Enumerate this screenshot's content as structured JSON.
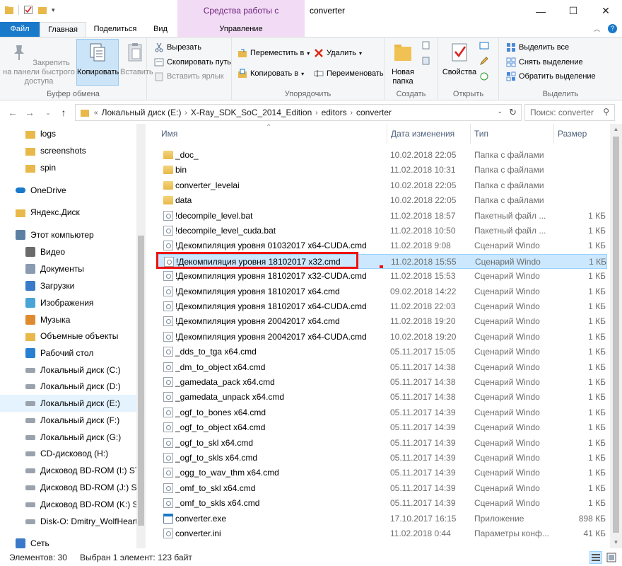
{
  "window": {
    "title": "converter",
    "context_tab_title": "Средства работы с приложениями",
    "controls": [
      "—",
      "☐",
      "✕"
    ]
  },
  "tabs": {
    "file": "Файл",
    "home": "Главная",
    "share": "Поделиться",
    "view": "Вид",
    "manage": "Управление"
  },
  "ribbon": {
    "clipboard": {
      "label": "Буфер обмена",
      "pin": "Закрепить на панели быстрого доступа",
      "copy": "Копировать",
      "paste": "Вставить",
      "cut": "Вырезать",
      "copy_path": "Скопировать путь",
      "paste_shortcut": "Вставить ярлык"
    },
    "organize": {
      "label": "Упорядочить",
      "move_to": "Переместить в",
      "copy_to": "Копировать в",
      "delete": "Удалить",
      "rename": "Переименовать"
    },
    "new": {
      "label": "Создать",
      "new_folder": "Новая папка"
    },
    "open": {
      "label": "Открыть",
      "properties": "Свойства"
    },
    "select": {
      "label": "Выделить",
      "select_all": "Выделить все",
      "select_none": "Снять выделение",
      "invert": "Обратить выделение"
    }
  },
  "address": {
    "prefix": "«",
    "crumbs": [
      "Локальный диск (E:)",
      "X-Ray_SDK_SoC_2014_Edition",
      "editors",
      "converter"
    ],
    "search_placeholder": "Поиск: converter"
  },
  "nav_pane": [
    {
      "label": "logs",
      "icon": "folder-icon"
    },
    {
      "label": "screenshots",
      "icon": "folder-icon"
    },
    {
      "label": "spin",
      "icon": "folder-icon"
    },
    {
      "label": "OneDrive",
      "icon": "cloud-icon"
    },
    {
      "label": "Яндекс.Диск",
      "icon": "folder-icon"
    },
    {
      "label": "Этот компьютер",
      "icon": "computer-icon"
    },
    {
      "label": "Видео",
      "icon": "video-icon"
    },
    {
      "label": "Документы",
      "icon": "documents-icon"
    },
    {
      "label": "Загрузки",
      "icon": "downloads-icon"
    },
    {
      "label": "Изображения",
      "icon": "pictures-icon"
    },
    {
      "label": "Музыка",
      "icon": "music-icon"
    },
    {
      "label": "Объемные объекты",
      "icon": "3d-objects-icon"
    },
    {
      "label": "Рабочий стол",
      "icon": "desktop-icon"
    },
    {
      "label": "Локальный диск (C:)",
      "icon": "drive-icon"
    },
    {
      "label": "Локальный диск (D:)",
      "icon": "drive-icon"
    },
    {
      "label": "Локальный диск (E:)",
      "icon": "drive-icon"
    },
    {
      "label": "Локальный диск (F:)",
      "icon": "drive-icon"
    },
    {
      "label": "Локальный диск (G:)",
      "icon": "drive-icon"
    },
    {
      "label": "CD-дисковод (H:)",
      "icon": "cd-drive-icon"
    },
    {
      "label": "Дисковод BD-ROM (I:) STA",
      "icon": "bd-drive-icon"
    },
    {
      "label": "Дисковод BD-ROM (J:) STA",
      "icon": "bd-drive-icon"
    },
    {
      "label": "Дисковод BD-ROM (K:) ST",
      "icon": "bd-drive-icon"
    },
    {
      "label": "Disk-O: Dmitry_WolfHeart(",
      "icon": "cloud-drive-icon"
    },
    {
      "label": "Сеть",
      "icon": "network-icon"
    }
  ],
  "columns": {
    "name": "Имя",
    "date": "Дата изменения",
    "type": "Тип",
    "size": "Размер"
  },
  "files": [
    {
      "name": "_doc_",
      "date": "10.02.2018 22:05",
      "type": "Папка с файлами",
      "size": "",
      "icon": "folder-icon"
    },
    {
      "name": "bin",
      "date": "11.02.2018 10:31",
      "type": "Папка с файлами",
      "size": "",
      "icon": "folder-icon"
    },
    {
      "name": "converter_levelai",
      "date": "10.02.2018 22:05",
      "type": "Папка с файлами",
      "size": "",
      "icon": "folder-icon"
    },
    {
      "name": "data",
      "date": "10.02.2018 22:05",
      "type": "Папка с файлами",
      "size": "",
      "icon": "folder-icon"
    },
    {
      "name": "!decompile_level.bat",
      "date": "11.02.2018 18:57",
      "type": "Пакетный файл ...",
      "size": "1 КБ",
      "icon": "batch-file-icon"
    },
    {
      "name": "!decompile_level_cuda.bat",
      "date": "11.02.2018 10:50",
      "type": "Пакетный файл ...",
      "size": "1 КБ",
      "icon": "batch-file-icon"
    },
    {
      "name": "!Декомпиляция уровня 01032017 x64-CUDA.cmd",
      "date": "11.02.2018 9:08",
      "type": "Сценарий Windo",
      "size": "1 КБ",
      "icon": "script-file-icon"
    },
    {
      "name": "!Декомпиляция уровня 18102017 x32.cmd",
      "date": "11.02.2018 15:55",
      "type": "Сценарий Windo",
      "size": "1 КБ",
      "icon": "script-file-icon",
      "selected": true
    },
    {
      "name": "!Декомпиляция уровня 18102017 x32-CUDA.cmd",
      "date": "11.02.2018 15:53",
      "type": "Сценарий Windo",
      "size": "1 КБ",
      "icon": "script-file-icon"
    },
    {
      "name": "!Декомпиляция уровня 18102017 x64.cmd",
      "date": "09.02.2018 14:22",
      "type": "Сценарий Windo",
      "size": "1 КБ",
      "icon": "script-file-icon"
    },
    {
      "name": "!Декомпиляция уровня 18102017 x64-CUDA.cmd",
      "date": "11.02.2018 22:03",
      "type": "Сценарий Windo",
      "size": "1 КБ",
      "icon": "script-file-icon"
    },
    {
      "name": "!Декомпиляция уровня 20042017 x64.cmd",
      "date": "11.02.2018 19:20",
      "type": "Сценарий Windo",
      "size": "1 КБ",
      "icon": "script-file-icon"
    },
    {
      "name": "!Декомпиляция уровня 20042017 x64-CUDA.cmd",
      "date": "10.02.2018 19:20",
      "type": "Сценарий Windo",
      "size": "1 КБ",
      "icon": "script-file-icon"
    },
    {
      "name": "_dds_to_tga x64.cmd",
      "date": "05.11.2017 15:05",
      "type": "Сценарий Windo",
      "size": "1 КБ",
      "icon": "script-file-icon"
    },
    {
      "name": "_dm_to_object  x64.cmd",
      "date": "05.11.2017 14:38",
      "type": "Сценарий Windo",
      "size": "1 КБ",
      "icon": "script-file-icon"
    },
    {
      "name": "_gamedata_pack  x64.cmd",
      "date": "05.11.2017 14:38",
      "type": "Сценарий Windo",
      "size": "1 КБ",
      "icon": "script-file-icon"
    },
    {
      "name": "_gamedata_unpack  x64.cmd",
      "date": "05.11.2017 14:38",
      "type": "Сценарий Windo",
      "size": "1 КБ",
      "icon": "script-file-icon"
    },
    {
      "name": "_ogf_to_bones x64.cmd",
      "date": "05.11.2017 14:39",
      "type": "Сценарий Windo",
      "size": "1 КБ",
      "icon": "script-file-icon"
    },
    {
      "name": "_ogf_to_object  x64.cmd",
      "date": "05.11.2017 14:39",
      "type": "Сценарий Windo",
      "size": "1 КБ",
      "icon": "script-file-icon"
    },
    {
      "name": "_ogf_to_skl  x64.cmd",
      "date": "05.11.2017 14:39",
      "type": "Сценарий Windo",
      "size": "1 КБ",
      "icon": "script-file-icon"
    },
    {
      "name": "_ogf_to_skls  x64.cmd",
      "date": "05.11.2017 14:39",
      "type": "Сценарий Windo",
      "size": "1 КБ",
      "icon": "script-file-icon"
    },
    {
      "name": "_ogg_to_wav_thm x64.cmd",
      "date": "05.11.2017 14:39",
      "type": "Сценарий Windo",
      "size": "1 КБ",
      "icon": "script-file-icon"
    },
    {
      "name": "_omf_to_skl  x64.cmd",
      "date": "05.11.2017 14:39",
      "type": "Сценарий Windo",
      "size": "1 КБ",
      "icon": "script-file-icon"
    },
    {
      "name": "_omf_to_skls  x64.cmd",
      "date": "05.11.2017 14:39",
      "type": "Сценарий Windo",
      "size": "1 КБ",
      "icon": "script-file-icon"
    },
    {
      "name": "converter.exe",
      "date": "17.10.2017 16:15",
      "type": "Приложение",
      "size": "898 КБ",
      "icon": "exe-file-icon"
    },
    {
      "name": "converter.ini",
      "date": "11.02.2018 0:44",
      "type": "Параметры конф...",
      "size": "41 КБ",
      "icon": "ini-file-icon"
    }
  ],
  "status": {
    "items_count": "Элементов: 30",
    "selection": "Выбран 1 элемент: 123 байт"
  },
  "colors": {
    "file_tab": "#1979ca",
    "context_tab": "#f2dcf5",
    "selected_row": "#cce8ff",
    "highlight_box": "#e11111"
  }
}
